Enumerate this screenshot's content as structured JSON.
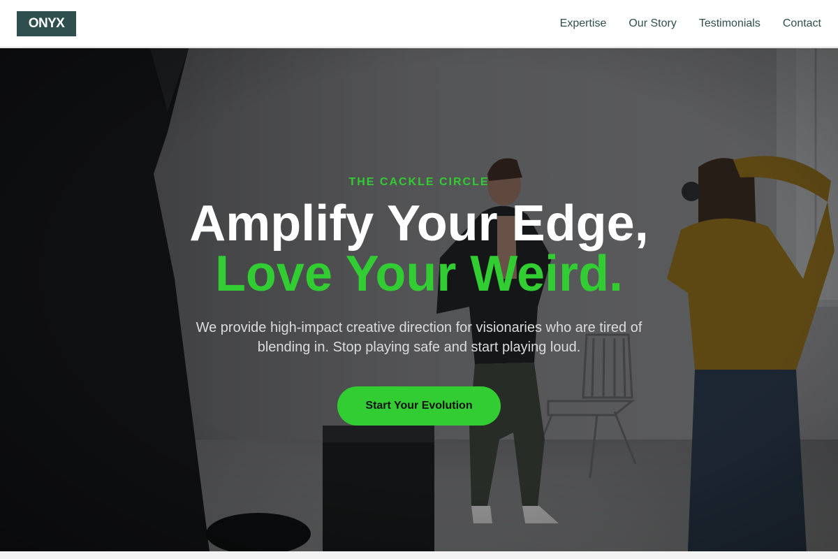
{
  "nav": {
    "logo": "ONYX",
    "links": [
      "Expertise",
      "Our Story",
      "Testimonials",
      "Contact"
    ]
  },
  "hero": {
    "eyebrow": "THE CACKLE CIRCLE",
    "headline_line1": "Amplify Your Edge,",
    "headline_line2": "Love Your Weird.",
    "subtext": "We provide high-impact creative direction for visionaries who are tired of blending in. Stop playing safe and start playing loud.",
    "cta_label": "Start Your Evolution",
    "background_image": "photo-studio-shoot"
  },
  "colors": {
    "brand_dark": "#2f4f4f",
    "accent_green": "#32cd32",
    "white": "#ffffff"
  }
}
